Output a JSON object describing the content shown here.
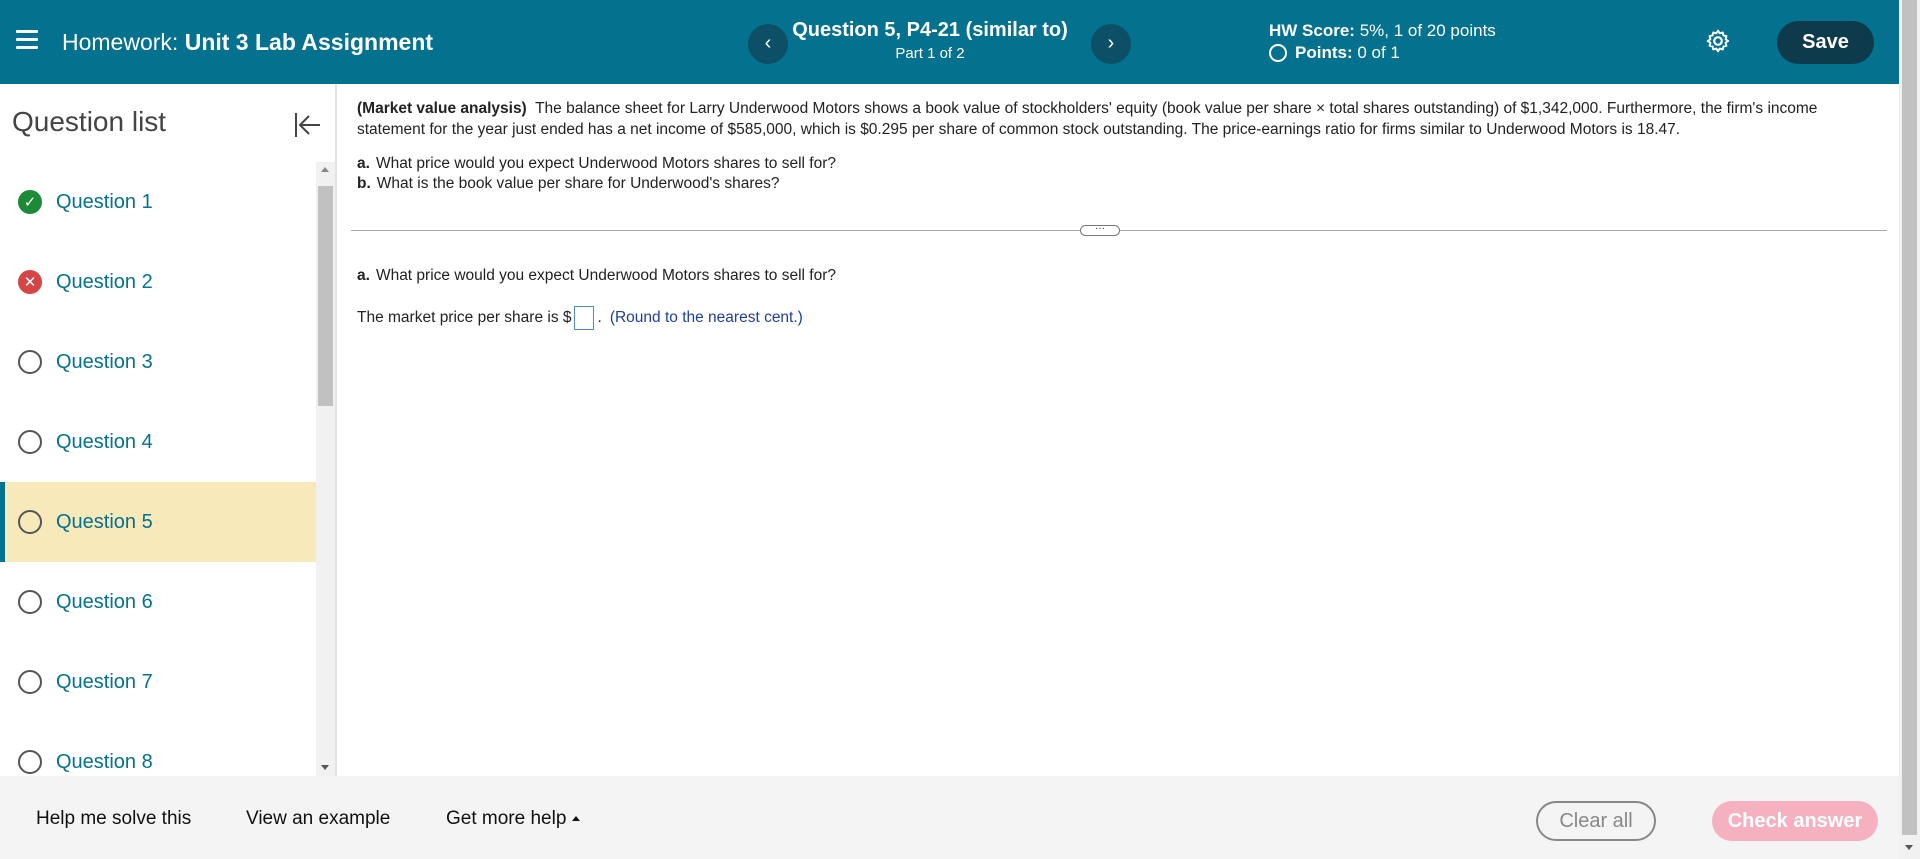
{
  "header": {
    "prefix": "Homework:",
    "title": "Unit 3 Lab Assignment",
    "question_title": "Question 5, P4-21 (similar to)",
    "part": "Part 1 of 2",
    "hw_score_label": "HW Score:",
    "hw_score_value": "5%, 1 of 20 points",
    "points_label": "Points:",
    "points_value": "0 of 1",
    "prev_glyph": "‹",
    "next_glyph": "›",
    "save_label": "Save",
    "icons": [
      "menu-icon",
      "gear-icon",
      "chevron-left-icon",
      "chevron-right-icon"
    ],
    "colors": {
      "bar": "#04718f",
      "save": "#0e3b4c"
    }
  },
  "sidebar": {
    "title": "Question list",
    "items": [
      {
        "label": "Question 1",
        "status": "correct"
      },
      {
        "label": "Question 2",
        "status": "incorrect"
      },
      {
        "label": "Question 3",
        "status": "unanswered"
      },
      {
        "label": "Question 4",
        "status": "unanswered"
      },
      {
        "label": "Question 5",
        "status": "unanswered",
        "active": true
      },
      {
        "label": "Question 6",
        "status": "unanswered"
      },
      {
        "label": "Question 7",
        "status": "unanswered"
      },
      {
        "label": "Question 8",
        "status": "unanswered"
      }
    ]
  },
  "problem": {
    "heading": "(Market value analysis)",
    "text": "The balance sheet for Larry Underwood Motors shows a book value of stockholders' equity (book value per share × total shares outstanding) of $1,342,000.  Furthermore, the firm's income statement for the year just ended has a net income of $585,000, which is $0.295 per share of common stock outstanding.  The price-earnings ratio for firms similar to Underwood Motors is 18.47.",
    "part_a_letter": "a.",
    "part_a": "What price would you expect Underwood Motors shares to sell for?",
    "part_b_letter": "b.",
    "part_b": "What is the book value per share for Underwood's shares?"
  },
  "answer": {
    "part_letter": "a.",
    "question": "What price would you expect Underwood Motors shares to sell for?",
    "prompt": "The market price per share is $",
    "suffix": ".",
    "value": "",
    "note": "(Round to the nearest cent.)"
  },
  "footer": {
    "help_me_solve": "Help me solve this",
    "view_example": "View an example",
    "get_more_help": "Get more help",
    "clear_all": "Clear all",
    "check_answer": "Check answer"
  }
}
